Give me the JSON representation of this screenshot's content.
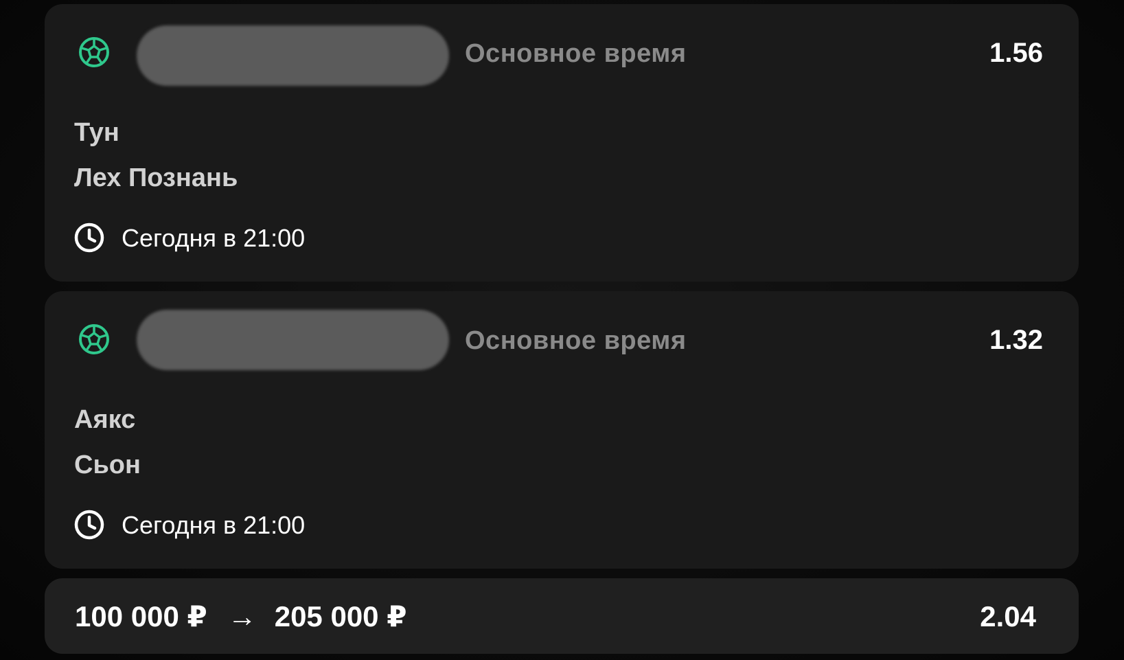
{
  "colors": {
    "accent_green": "#2fc88c",
    "card_bg": "#1a1a1a",
    "muted_text": "#8a8a8a"
  },
  "bets": [
    {
      "sport_icon": "soccer-ball-icon",
      "market": "Основное время",
      "odds": "1.56",
      "home_team": "Тун",
      "away_team": "Лех Познань",
      "time_icon": "clock-icon",
      "time": "Сегодня в 21:00"
    },
    {
      "sport_icon": "soccer-ball-icon",
      "market": "Основное время",
      "odds": "1.32",
      "home_team": "Аякс",
      "away_team": "Сьон",
      "time_icon": "clock-icon",
      "time": "Сегодня в 21:00"
    }
  ],
  "summary": {
    "stake": "100 000 ₽",
    "arrow": "→",
    "payout": "205 000 ₽",
    "total_odds": "2.04"
  }
}
